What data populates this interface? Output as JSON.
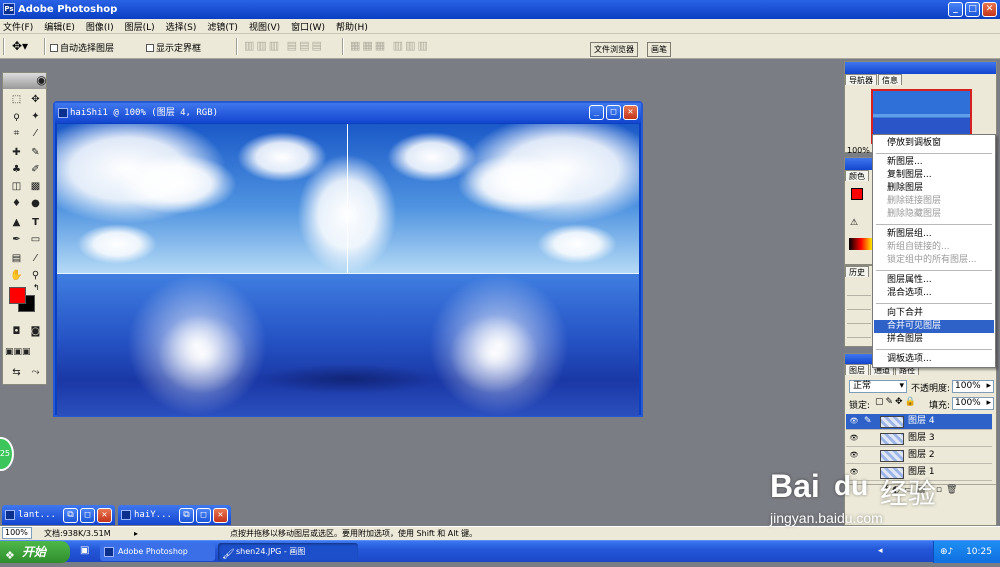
{
  "app": {
    "title": "Adobe Photoshop",
    "icon_label": "Ps"
  },
  "menu": [
    "文件(F)",
    "编辑(E)",
    "图像(I)",
    "图层(L)",
    "选择(S)",
    "滤镜(T)",
    "视图(V)",
    "窗口(W)",
    "帮助(H)"
  ],
  "options": {
    "auto_select": "自动选择图层",
    "show_bounds": "显示定界框",
    "file_browser": "文件浏览器",
    "brush": "画笔"
  },
  "document": {
    "title": "haiShi1 @ 100% (图层 4, RGB)"
  },
  "navigator": {
    "tab_nav": "导航器",
    "tab_info": "信息",
    "zoom": "100%"
  },
  "color_panel": {
    "tab": "颜色"
  },
  "history_panel": {
    "tab": "历史"
  },
  "context_menu": {
    "items": [
      {
        "label": "停放到调板窗",
        "enabled": true
      },
      {
        "label": "新图层...",
        "enabled": true
      },
      {
        "label": "复制图层...",
        "enabled": true
      },
      {
        "label": "删除图层",
        "enabled": true
      },
      {
        "label": "删除链接图层",
        "enabled": false
      },
      {
        "label": "删除隐藏图层",
        "enabled": false
      },
      {
        "label": "新图层组...",
        "enabled": true
      },
      {
        "label": "新组自链接的...",
        "enabled": false
      },
      {
        "label": "锁定组中的所有图层...",
        "enabled": false
      },
      {
        "label": "图层属性...",
        "enabled": true
      },
      {
        "label": "混合选项...",
        "enabled": true
      },
      {
        "label": "向下合并",
        "enabled": true
      },
      {
        "label": "合并可见图层",
        "enabled": true,
        "highlighted": true
      },
      {
        "label": "拼合图层",
        "enabled": true
      },
      {
        "label": "调板选项...",
        "enabled": true
      }
    ]
  },
  "layers_panel": {
    "tabs": [
      "图层",
      "通道",
      "路径"
    ],
    "blend_mode": "正常",
    "opacity_label": "不透明度:",
    "opacity": "100%",
    "lock_label": "锁定:",
    "fill_label": "填充:",
    "fill": "100%",
    "layers": [
      "图层 4",
      "图层 3",
      "图层 2",
      "图层 1"
    ],
    "selected": 0
  },
  "minimized": [
    {
      "title": "lant..."
    },
    {
      "title": "haiY..."
    }
  ],
  "status": {
    "zoom": "100%",
    "doc_size": "文档:938K/3.51M",
    "hint": "点按并拖移以移动图层或选区。要用附加选项，使用 Shift 和 Alt 键。"
  },
  "taskbar": {
    "start": "开始",
    "tasks": [
      "Adobe Photoshop",
      "shen24.JPG - 画图"
    ],
    "clock": "10:25"
  },
  "watermark": {
    "brand": "Bai",
    "paw": "du",
    "cn": "经验",
    "url": "jingyan.baidu.com"
  },
  "badge": "25",
  "colors": {
    "fg": "#ff0000",
    "bg": "#000000",
    "xp_blue": "#0a3fc2",
    "highlight": "#2e62c8"
  }
}
